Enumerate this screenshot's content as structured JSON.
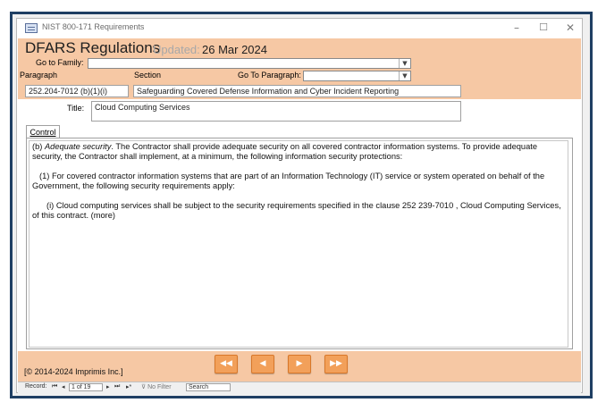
{
  "window": {
    "title": "NIST 800-171 Requirements",
    "min_glyph": "–",
    "max_glyph": "☐",
    "close_glyph": "✕"
  },
  "header": {
    "title": "DFARS Regulations",
    "updated_label": "Updated:",
    "updated_date": "26 Mar 2024",
    "go_to_family_label": "Go to Family:",
    "go_to_family_value": "",
    "paragraph_label": "Paragraph",
    "section_label": "Section",
    "go_to_paragraph_label": "Go To Paragraph:",
    "go_to_paragraph_value": ""
  },
  "record": {
    "paragraph": "252.204-7012 (b)(1)(i)",
    "section": "Safeguarding Covered Defense Information and Cyber Incident Reporting",
    "title_label": "Title:",
    "title": "Cloud Computing Services"
  },
  "tabs": [
    {
      "label": "Control"
    }
  ],
  "control": {
    "p1_prefix": "(b) ",
    "p1_italic": "Adequate security",
    "p1_rest": ". The Contractor shall provide adequate security on all covered contractor information systems. To provide adequate security, the Contractor shall implement, at a minimum, the following information security protections:",
    "p2": "(1) For covered contractor information systems that are part of an Information Technology (IT) service or system operated on behalf of the Government, the following security requirements apply:",
    "p3": "(i) Cloud computing services shall be subject to the security requirements specified in the clause 252 239-7010 , Cloud Computing Services, of this contract. (more)"
  },
  "footer": {
    "copyright": "[© 2014-2024 Imprimis Inc.]",
    "nav": [
      {
        "name": "first-record-button",
        "glyph": "◀◀"
      },
      {
        "name": "previous-record-button",
        "glyph": "◀"
      },
      {
        "name": "next-record-button",
        "glyph": "▶"
      },
      {
        "name": "last-record-button",
        "glyph": "▶▶"
      }
    ]
  },
  "record_nav": {
    "label": "Record:",
    "first": "⏮",
    "prev": "◂",
    "position": "1 of 19",
    "next": "▸",
    "last": "⏭",
    "new": "▸*",
    "filter": "No Filter",
    "search": "Search"
  },
  "colors": {
    "accent": "#f6c8a4",
    "nav_button": "#f2a05a",
    "frame": "#1f3f63"
  }
}
